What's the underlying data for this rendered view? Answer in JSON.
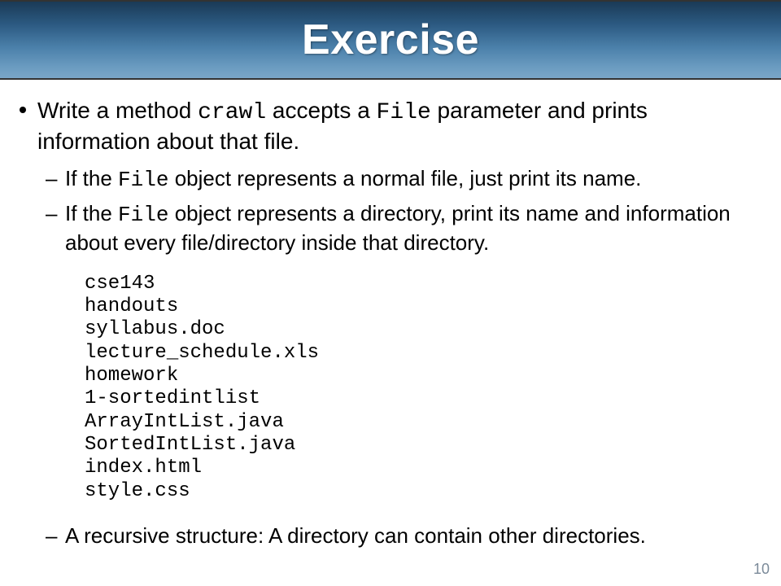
{
  "header": {
    "title": "Exercise"
  },
  "content": {
    "main": {
      "part1": "Write a method ",
      "code1": "crawl",
      "part2": " accepts a ",
      "code2": "File",
      "part3": " parameter and prints information about that file."
    },
    "sub1": {
      "part1": "If the ",
      "code1": "File",
      "part2": " object represents a normal file, just print its name."
    },
    "sub2": {
      "part1": "If the ",
      "code1": "File",
      "part2": " object represents a directory, print its name and information about every file/directory inside that directory."
    },
    "code": "cse143\nhandouts\nsyllabus.doc\nlecture_schedule.xls\nhomework\n1-sortedintlist\nArrayIntList.java\nSortedIntList.java\nindex.html\nstyle.css",
    "sub3": "A recursive structure: A directory can contain other directories."
  },
  "footer": {
    "page": "10"
  }
}
